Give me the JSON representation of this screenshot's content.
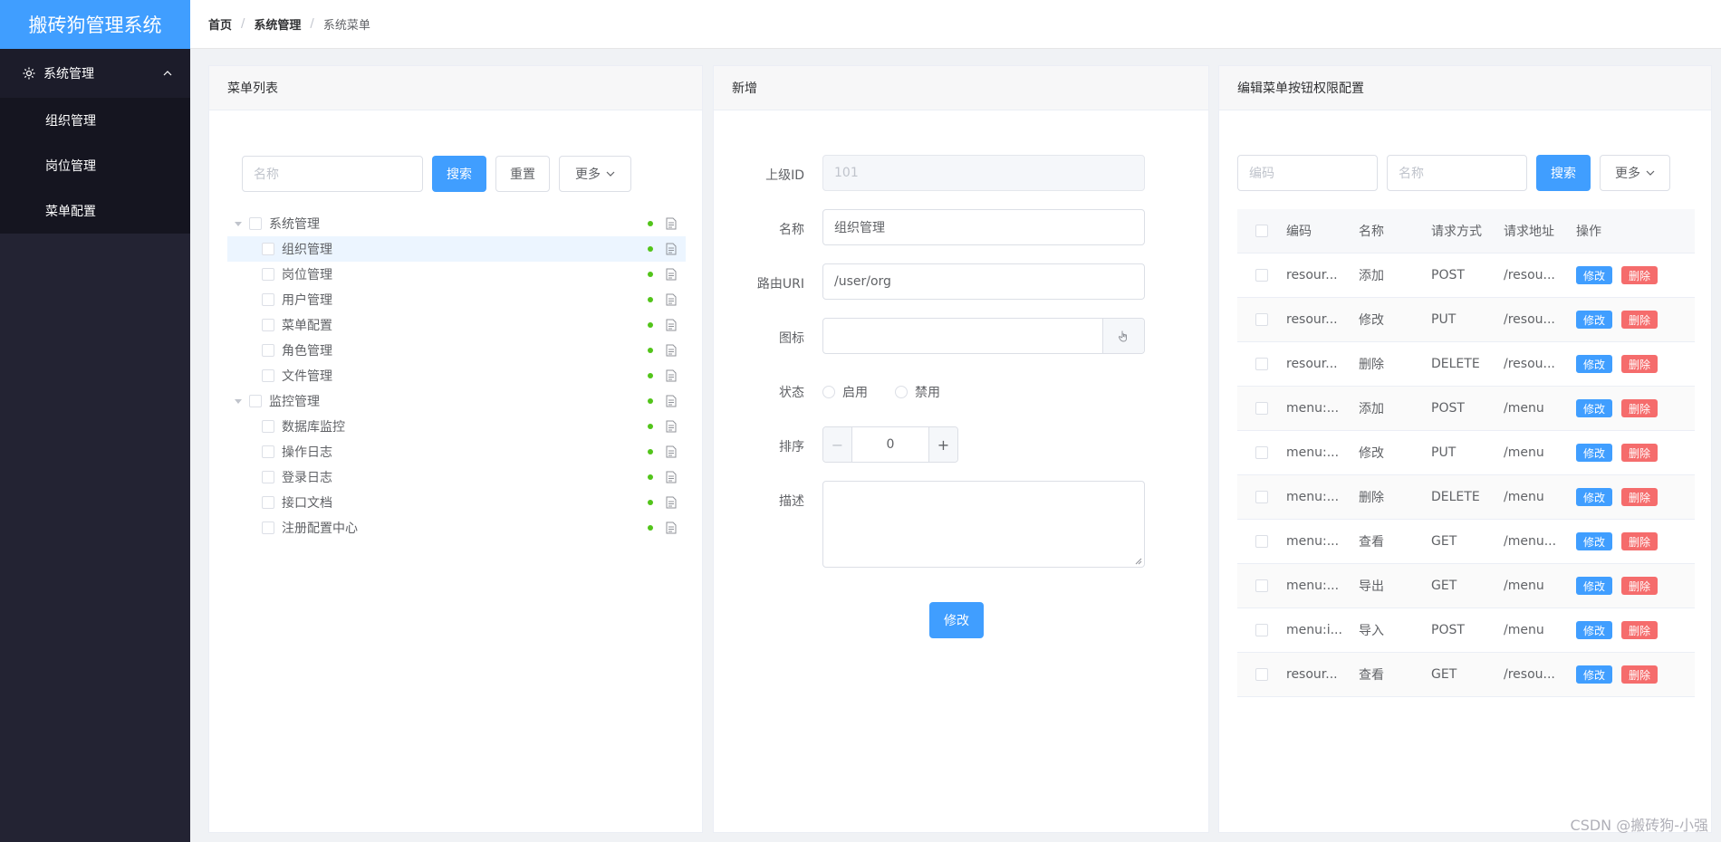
{
  "app": {
    "title": "搬砖狗管理系统"
  },
  "sidebar": {
    "group_label": "系统管理",
    "items": [
      {
        "label": "组织管理"
      },
      {
        "label": "岗位管理"
      },
      {
        "label": "菜单配置"
      }
    ]
  },
  "breadcrumb": [
    "首页",
    "系统管理",
    "系统菜单"
  ],
  "left_panel": {
    "title": "菜单列表",
    "search_placeholder": "名称",
    "search_label": "搜索",
    "reset_label": "重置",
    "more_label": "更多",
    "tree": [
      {
        "label": "系统管理",
        "level": 0,
        "expandable": true
      },
      {
        "label": "组织管理",
        "level": 1,
        "selected": true
      },
      {
        "label": "岗位管理",
        "level": 1
      },
      {
        "label": "用户管理",
        "level": 1
      },
      {
        "label": "菜单配置",
        "level": 1
      },
      {
        "label": "角色管理",
        "level": 1
      },
      {
        "label": "文件管理",
        "level": 1
      },
      {
        "label": "监控管理",
        "level": 0,
        "expandable": true
      },
      {
        "label": "数据库监控",
        "level": 1
      },
      {
        "label": "操作日志",
        "level": 1
      },
      {
        "label": "登录日志",
        "level": 1
      },
      {
        "label": "接口文档",
        "level": 1
      },
      {
        "label": "注册配置中心",
        "level": 1
      }
    ]
  },
  "form_panel": {
    "title": "新增",
    "parent_id_label": "上级ID",
    "parent_id_value": "101",
    "name_label": "名称",
    "name_value": "组织管理",
    "route_label": "路由URI",
    "route_value": "/user/org",
    "icon_label": "图标",
    "status_label": "状态",
    "status_enable": "启用",
    "status_disable": "禁用",
    "sort_label": "排序",
    "sort_value": "0",
    "desc_label": "描述",
    "submit_label": "修改"
  },
  "right_panel": {
    "title": "编辑菜单按钮权限配置",
    "code_placeholder": "编码",
    "name_placeholder": "名称",
    "search_label": "搜索",
    "more_label": "更多",
    "columns": [
      "编码",
      "名称",
      "请求方式",
      "请求地址",
      "操作"
    ],
    "edit_label": "修改",
    "delete_label": "删除",
    "rows": [
      {
        "code": "resour...",
        "name": "添加",
        "method": "POST",
        "url": "/resou..."
      },
      {
        "code": "resour...",
        "name": "修改",
        "method": "PUT",
        "url": "/resou..."
      },
      {
        "code": "resour...",
        "name": "删除",
        "method": "DELETE",
        "url": "/resou..."
      },
      {
        "code": "menu:...",
        "name": "添加",
        "method": "POST",
        "url": "/menu"
      },
      {
        "code": "menu:...",
        "name": "修改",
        "method": "PUT",
        "url": "/menu"
      },
      {
        "code": "menu:...",
        "name": "删除",
        "method": "DELETE",
        "url": "/menu"
      },
      {
        "code": "menu:...",
        "name": "查看",
        "method": "GET",
        "url": "/menu..."
      },
      {
        "code": "menu:...",
        "name": "导出",
        "method": "GET",
        "url": "/menu"
      },
      {
        "code": "menu:i...",
        "name": "导入",
        "method": "POST",
        "url": "/menu"
      },
      {
        "code": "resour...",
        "name": "查看",
        "method": "GET",
        "url": "/resou..."
      }
    ]
  },
  "watermark": "CSDN @搬砖狗-小强"
}
